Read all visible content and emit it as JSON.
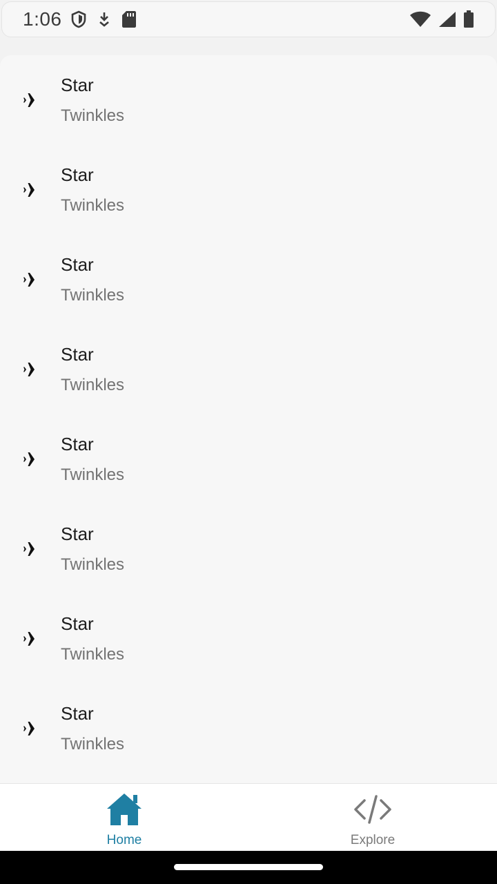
{
  "status_bar": {
    "time": "1:06",
    "left_icons": [
      "shield-icon",
      "download-icon",
      "sd-card-icon"
    ],
    "right_icons": [
      "wifi-icon",
      "cellular-signal-icon",
      "battery-icon"
    ]
  },
  "list": {
    "items": [
      {
        "title": "Star",
        "subtitle": "Twinkles",
        "icon": "airplane-icon"
      },
      {
        "title": "Star",
        "subtitle": "Twinkles",
        "icon": "airplane-icon"
      },
      {
        "title": "Star",
        "subtitle": "Twinkles",
        "icon": "airplane-icon"
      },
      {
        "title": "Star",
        "subtitle": "Twinkles",
        "icon": "airplane-icon"
      },
      {
        "title": "Star",
        "subtitle": "Twinkles",
        "icon": "airplane-icon"
      },
      {
        "title": "Star",
        "subtitle": "Twinkles",
        "icon": "airplane-icon"
      },
      {
        "title": "Star",
        "subtitle": "Twinkles",
        "icon": "airplane-icon"
      },
      {
        "title": "Star",
        "subtitle": "Twinkles",
        "icon": "airplane-icon"
      }
    ]
  },
  "bottom_nav": {
    "items": [
      {
        "label": "Home",
        "icon": "home-icon",
        "selected": true
      },
      {
        "label": "Explore",
        "icon": "code-icon",
        "selected": false
      }
    ]
  },
  "colors": {
    "accent": "#1f7fa3",
    "background": "#f7f7f7",
    "inactive": "#7a7a7a"
  }
}
